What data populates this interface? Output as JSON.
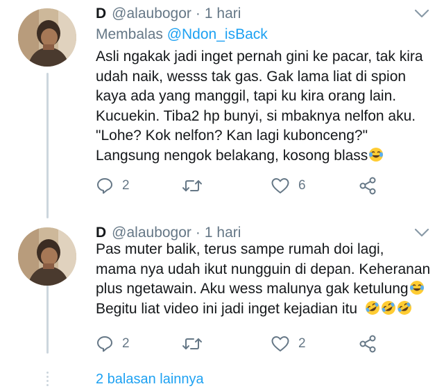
{
  "tweets": [
    {
      "name": "D",
      "handle": "@alaubogor",
      "separator": "·",
      "time": "1 hari",
      "reply_prefix": "Membalas ",
      "reply_mention": "@Ndon_isBack",
      "lines": [
        "Asli ngakak jadi inget pernah gini ke pacar, tak kira",
        "udah naik, wesss tak gas. Gak lama liat di spion",
        "kaya ada yang manggil, tapi ku kira orang lain.",
        "Kucuekin. Tiba2 hp bunyi, si mbaknya nelfon aku.",
        "\"Lohe? Kok nelfon? Kan lagi kubonceng?\"",
        "Langsung nengok belakang, kosong blass"
      ],
      "emojis": [
        "face-with-tears-of-joy"
      ],
      "reply_count": "2",
      "retweet_count": "",
      "like_count": "6"
    },
    {
      "name": "D",
      "handle": "@alaubogor",
      "separator": "·",
      "time": "1 hari",
      "lines": [
        "Pas muter balik, terus sampe rumah doi lagi,",
        "mama nya udah ikut nungguin di depan. Keheranan",
        "plus ngetawain. Aku wess malunya gak ketulung",
        "Begitu liat video ini jadi inget kejadian itu"
      ],
      "emojis": [
        "face-with-tears-of-joy",
        "rolling-on-floor-laughing",
        "rolling-on-floor-laughing",
        "rolling-on-floor-laughing"
      ],
      "reply_count": "2",
      "retweet_count": "",
      "like_count": "2"
    }
  ],
  "more_replies": "2 balasan lainnya",
  "icons": {
    "reply": "reply-icon",
    "retweet": "retweet-icon",
    "like": "heart-icon",
    "share": "share-icon",
    "menu": "chevron-down-icon"
  },
  "colors": {
    "text": "#14171a",
    "muted": "#657786",
    "link": "#1da1f2",
    "thread_line": "#ccd6dd"
  }
}
